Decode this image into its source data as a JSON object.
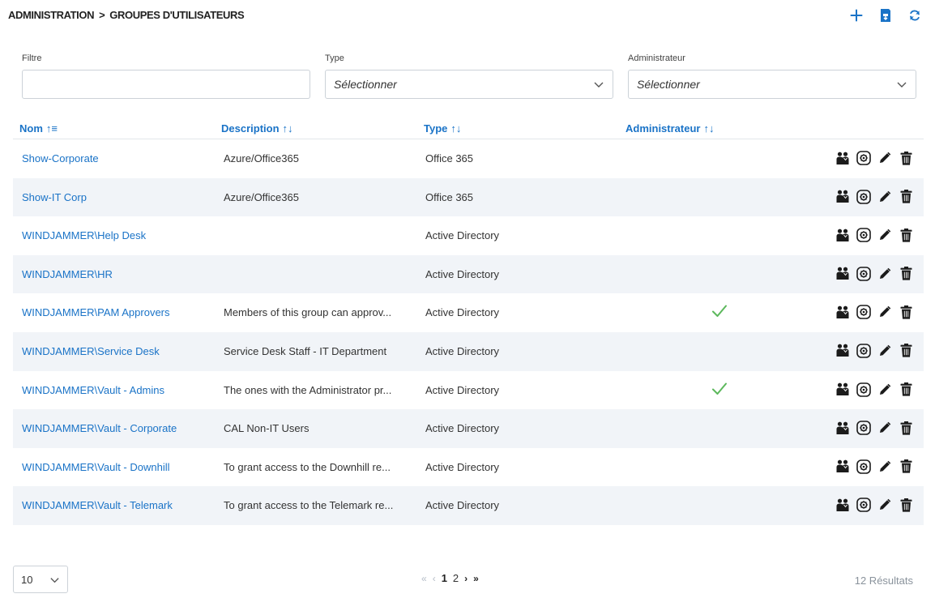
{
  "breadcrumb": {
    "root": "ADMINISTRATION",
    "separator": ">",
    "current": "GROUPES D'UTILISATEURS"
  },
  "top_actions": [
    {
      "name": "add-icon",
      "icon": "plus",
      "color": "#1a73c7"
    },
    {
      "name": "import-icon",
      "icon": "import",
      "color": "#1a73c7"
    },
    {
      "name": "refresh-icon",
      "icon": "refresh",
      "color": "#1a73c7"
    }
  ],
  "filters": {
    "filter": {
      "label": "Filtre",
      "value": "",
      "placeholder": ""
    },
    "type": {
      "label": "Type",
      "value": "Sélectionner"
    },
    "admin": {
      "label": "Administrateur",
      "value": "Sélectionner"
    }
  },
  "columns": {
    "name": "Nom",
    "name_sort": "↑≡",
    "description": "Description",
    "description_sort": "↑↓",
    "type": "Type",
    "type_sort": "↑↓",
    "admin": "Administrateur",
    "admin_sort": "↑↓"
  },
  "rows": [
    {
      "name": "Show-Corporate",
      "description": "Azure/Office365",
      "type": "Office 365",
      "admin": false
    },
    {
      "name": "Show-IT Corp",
      "description": "Azure/Office365",
      "type": "Office 365",
      "admin": false
    },
    {
      "name": "WINDJAMMER\\Help Desk",
      "description": "",
      "type": "Active Directory",
      "admin": false
    },
    {
      "name": "WINDJAMMER\\HR",
      "description": "",
      "type": "Active Directory",
      "admin": false
    },
    {
      "name": "WINDJAMMER\\PAM Approvers",
      "description": "Members of this group can approv...",
      "type": "Active Directory",
      "admin": true
    },
    {
      "name": "WINDJAMMER\\Service Desk",
      "description": "Service Desk Staff - IT Department",
      "type": "Active Directory",
      "admin": false
    },
    {
      "name": "WINDJAMMER\\Vault - Admins",
      "description": "The ones with the Administrator pr...",
      "type": "Active Directory",
      "admin": true
    },
    {
      "name": "WINDJAMMER\\Vault - Corporate",
      "description": "CAL Non-IT Users",
      "type": "Active Directory",
      "admin": false
    },
    {
      "name": "WINDJAMMER\\Vault - Downhill",
      "description": "To grant access to the Downhill re...",
      "type": "Active Directory",
      "admin": false
    },
    {
      "name": "WINDJAMMER\\Vault - Telemark",
      "description": "To grant access to the Telemark re...",
      "type": "Active Directory",
      "admin": false
    }
  ],
  "row_actions": [
    "members-icon",
    "settings-icon",
    "edit-icon",
    "delete-icon"
  ],
  "footer": {
    "page_size": "10",
    "first": "«",
    "prev": "‹",
    "pages": [
      "1",
      "2"
    ],
    "current_page": "1",
    "next": "›",
    "last": "»",
    "results": "12 Résultats"
  },
  "colors": {
    "accent": "#1a73c7",
    "check": "#5cb85c",
    "icon": "#1b1b1b",
    "alt_row": "#f1f4f8"
  }
}
